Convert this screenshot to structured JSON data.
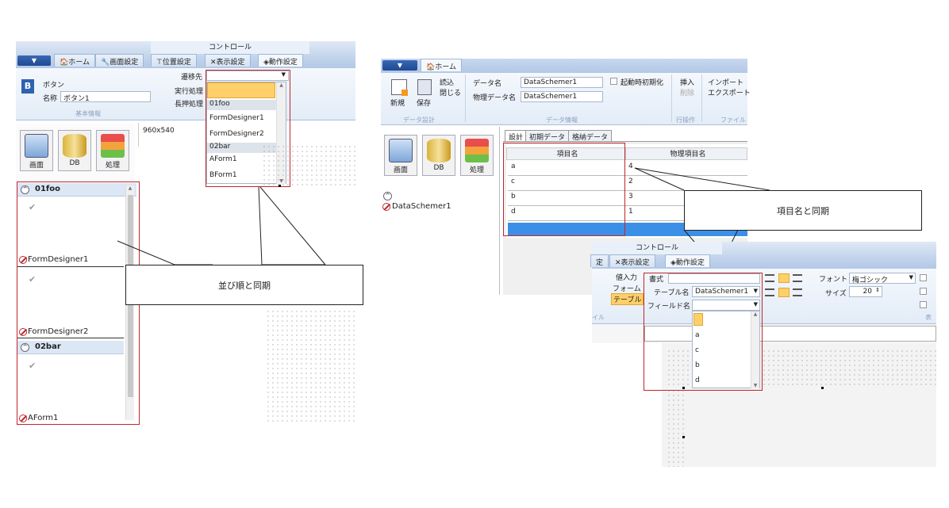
{
  "left": {
    "ribbon_title": "コントロール",
    "tabs": [
      "ホーム",
      "画面設定",
      "位置設定",
      "表示設定",
      "動作設定"
    ],
    "control_type": "ボタン",
    "name_label": "名称",
    "name_value": "ボタン1",
    "group_label": "基本情報",
    "nav_label": "遷移先",
    "exec_label": "実行処理",
    "longpress_label": "長押処理",
    "canvas_size": "960x540",
    "big_buttons": [
      "画面",
      "DB",
      "処理"
    ],
    "tree_groups": [
      {
        "name": "01foo",
        "items": [
          "FormDesigner1",
          "FormDesigner2"
        ]
      },
      {
        "name": "02bar",
        "items": [
          "AForm1"
        ]
      }
    ],
    "dropdown": [
      {
        "text": "01foo",
        "header": true
      },
      {
        "text": "FormDesigner1",
        "header": false
      },
      {
        "text": "FormDesigner2",
        "header": false
      },
      {
        "text": "02bar",
        "header": true
      },
      {
        "text": "AForm1",
        "header": false
      },
      {
        "text": "BForm1",
        "header": false
      }
    ],
    "callout": "並び順と同期"
  },
  "right": {
    "home_tab": "ホーム",
    "new_label": "新規",
    "save_label": "保存",
    "read_label": "読込",
    "close_label": "閉じる",
    "data_design_group": "データ設計",
    "data_name_label": "データ名",
    "data_name_value": "DataSchemer1",
    "physical_label": "物理データ名",
    "physical_value": "DataSchemer1",
    "startup_init": "起動時初期化",
    "data_info_group": "データ情報",
    "insert_label": "挿入",
    "delete_label": "削除",
    "row_group": "行操作",
    "import_label": "インポート",
    "export_label": "エクスポート",
    "file_group": "ファイル",
    "big_buttons": [
      "画面",
      "DB",
      "処理"
    ],
    "tree_item": "DataSchemer1",
    "sub_tabs": [
      "設計",
      "初期データ",
      "格納データ"
    ],
    "grid_headers": [
      "項目名",
      "物理項目名"
    ],
    "grid_rows": [
      {
        "name": "a",
        "physical": "4"
      },
      {
        "name": "c",
        "physical": "2"
      },
      {
        "name": "b",
        "physical": "3"
      },
      {
        "name": "d",
        "physical": "1"
      }
    ],
    "callout": "項目名と同期"
  },
  "overlay": {
    "ribbon_title": "コントロール",
    "tab_partial": "定",
    "tabs": [
      "表示設定",
      "動作設定"
    ],
    "labels_left": [
      "値入力",
      "フォーム",
      "テーブル"
    ],
    "group_partial": "イル",
    "format_label": "書式",
    "table_label": "テーブル名",
    "table_value": "DataSchemer1",
    "field_label": "フィールド名",
    "font_label": "フォント",
    "font_value": "梅ゴシック",
    "size_label": "サイズ",
    "size_value": "20",
    "group_partial_right": "表",
    "dropdown": [
      "",
      "a",
      "c",
      "b",
      "d"
    ]
  },
  "colors": {
    "accent_red": "#c0262c",
    "ribbon_blue": "#c9d9ee",
    "selected_blue": "#3b8fe6",
    "highlight": "#ffcf6a"
  }
}
